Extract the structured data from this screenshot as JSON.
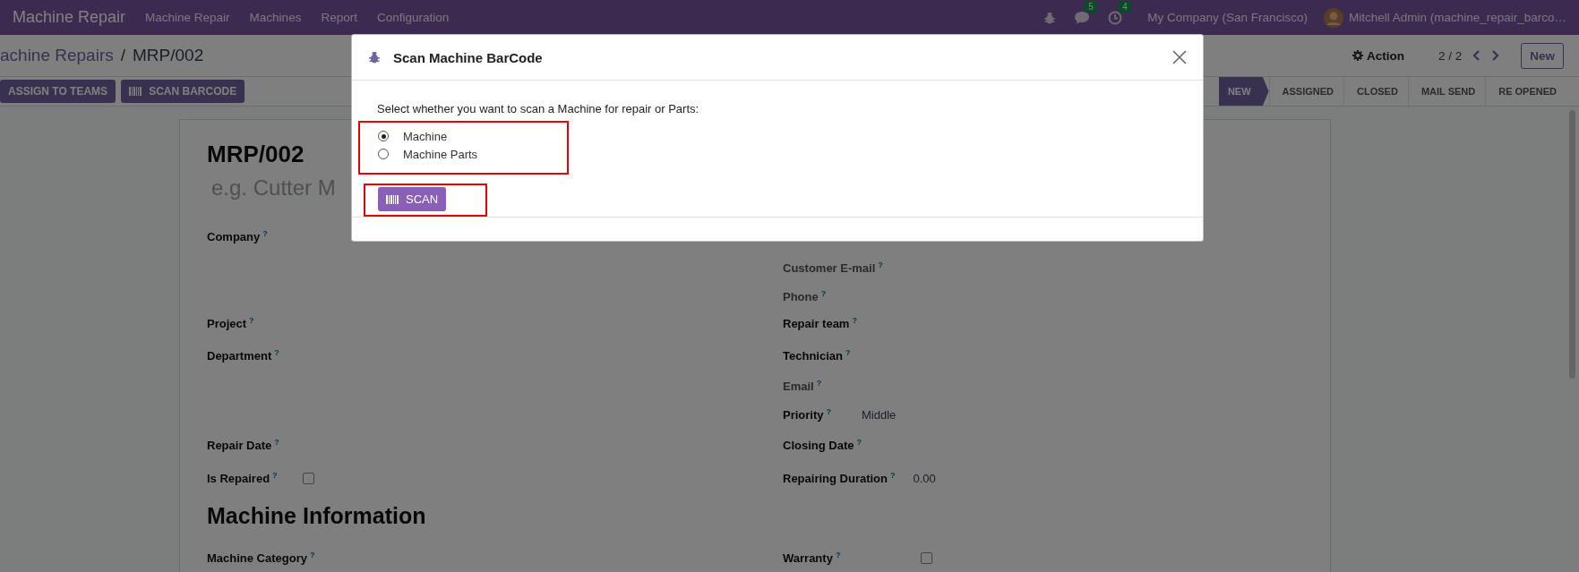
{
  "navbar": {
    "brand": "Machine Repair",
    "menu": [
      "Machine Repair",
      "Machines",
      "Report",
      "Configuration"
    ],
    "chat_count": "5",
    "activity_count": "4",
    "company": "My Company (San Francisco)",
    "user": "Mitchell Admin (machine_repair_barco…"
  },
  "control_panel": {
    "breadcrumb": [
      "achine Repairs",
      "MRP/002"
    ],
    "separator": "/",
    "action": "Action",
    "pager": "2 / 2",
    "new_button": "New"
  },
  "header_buttons": [
    {
      "label": "ASSIGN TO TEAMS",
      "kind": "plain"
    },
    {
      "label": "SCAN BARCODE",
      "kind": "barcode"
    }
  ],
  "status_steps": [
    {
      "label": "NEW",
      "selected": true
    },
    {
      "label": "ASSIGNED",
      "selected": false
    },
    {
      "label": "CLOSED",
      "selected": false
    },
    {
      "label": "MAIL SEND",
      "selected": false
    },
    {
      "label": "RE OPENED",
      "selected": false
    }
  ],
  "sheet": {
    "title": "MRP/002",
    "name_placeholder": "e.g. Cutter M",
    "left_fields": [
      {
        "label": "Company",
        "help": "?",
        "kind": "text",
        "muted": false
      },
      {
        "label": "Project",
        "help": "?",
        "kind": "text",
        "muted": false
      },
      {
        "label": "Department",
        "help": "?",
        "kind": "text",
        "muted": false
      },
      {
        "label": "Repair Date",
        "help": "?",
        "kind": "text",
        "muted": false
      },
      {
        "label": "Is Repaired",
        "help": "?",
        "kind": "checkbox",
        "checked": false,
        "muted": false
      }
    ],
    "right_fields": [
      {
        "label": "Customer E-mail",
        "help": "?",
        "kind": "text",
        "muted": true
      },
      {
        "label": "Phone",
        "help": "?",
        "kind": "text",
        "muted": true
      },
      {
        "label": "Repair team",
        "help": "?",
        "kind": "text",
        "muted": false
      },
      {
        "label": "Technician",
        "help": "?",
        "kind": "text",
        "muted": false
      },
      {
        "label": "Email",
        "help": "?",
        "kind": "text",
        "muted": true
      },
      {
        "label": "Priority",
        "help": "?",
        "kind": "text",
        "value": "Middle",
        "muted": false
      },
      {
        "label": "Closing Date",
        "help": "?",
        "kind": "text",
        "muted": false
      },
      {
        "label": "Repairing Duration",
        "help": "?",
        "kind": "text",
        "value": "0.00",
        "muted": false
      }
    ],
    "section_title": "Machine Information",
    "section_left": [
      {
        "label": "Machine Category",
        "help": "?",
        "muted": false
      }
    ],
    "section_right": [
      {
        "label": "Warranty",
        "help": "?",
        "kind": "checkbox",
        "checked": false,
        "muted": false
      }
    ]
  },
  "dialog": {
    "title": "Scan Machine BarCode",
    "prompt": "Select whether you want to scan a Machine for repair or Parts:",
    "options": [
      {
        "label": "Machine",
        "selected": true
      },
      {
        "label": "Machine Parts",
        "selected": false
      }
    ],
    "scan_button": "SCAN"
  }
}
